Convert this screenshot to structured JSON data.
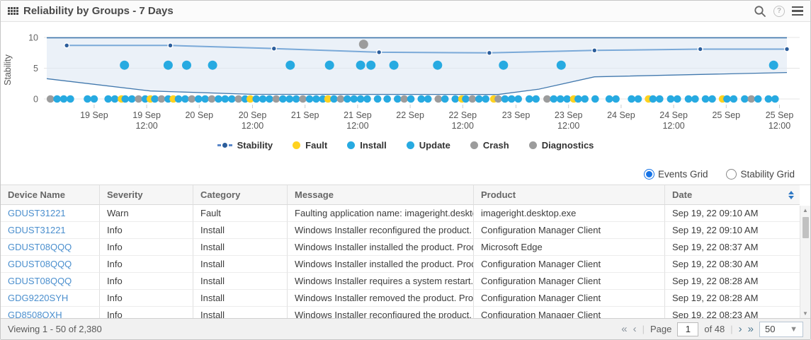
{
  "header": {
    "title": "Reliability by Groups - 7 Days"
  },
  "chart_data": {
    "type": "scatter",
    "title": "Reliability by Groups - 7 Days",
    "ylabel": "Stability",
    "ylim": [
      0,
      10
    ],
    "yticks": [
      {
        "v": 0,
        "label": "0"
      },
      {
        "v": 5,
        "label": "5"
      },
      {
        "v": 10,
        "label": "10"
      }
    ],
    "xticks": [
      {
        "x": 0.064,
        "l1": "19 Sep",
        "l2": ""
      },
      {
        "x": 0.135,
        "l1": "19 Sep",
        "l2": "12:00"
      },
      {
        "x": 0.206,
        "l1": "20 Sep",
        "l2": ""
      },
      {
        "x": 0.278,
        "l1": "20 Sep",
        "l2": "12:00"
      },
      {
        "x": 0.349,
        "l1": "21 Sep",
        "l2": ""
      },
      {
        "x": 0.42,
        "l1": "21 Sep",
        "l2": "12:00"
      },
      {
        "x": 0.491,
        "l1": "22 Sep",
        "l2": ""
      },
      {
        "x": 0.562,
        "l1": "22 Sep",
        "l2": "12:00"
      },
      {
        "x": 0.634,
        "l1": "23 Sep",
        "l2": ""
      },
      {
        "x": 0.705,
        "l1": "23 Sep",
        "l2": "12:00"
      },
      {
        "x": 0.776,
        "l1": "24 Sep",
        "l2": ""
      },
      {
        "x": 0.847,
        "l1": "24 Sep",
        "l2": "12:00"
      },
      {
        "x": 0.918,
        "l1": "25 Sep",
        "l2": ""
      },
      {
        "x": 0.99,
        "l1": "25 Sep",
        "l2": "12:00"
      }
    ],
    "band": {
      "upper": [
        [
          0,
          9.95
        ],
        [
          1,
          9.95
        ]
      ],
      "lower": [
        [
          0,
          3.3
        ],
        [
          0.14,
          1.3
        ],
        [
          0.28,
          0.75
        ],
        [
          0.61,
          0.72
        ],
        [
          0.665,
          1.6
        ],
        [
          0.74,
          3.6
        ],
        [
          1,
          4.3
        ]
      ]
    },
    "stability_line": [
      [
        0.027,
        8.7
      ],
      [
        0.167,
        8.7
      ],
      [
        0.307,
        8.2
      ],
      [
        0.449,
        7.6
      ],
      [
        0.598,
        7.5
      ],
      [
        0.74,
        7.9
      ],
      [
        0.883,
        8.1
      ],
      [
        1,
        8.1
      ]
    ],
    "update_points": {
      "y": 5.5,
      "x": [
        0.105,
        0.164,
        0.189,
        0.224,
        0.329,
        0.382,
        0.424,
        0.438,
        0.469,
        0.528,
        0.617,
        0.695,
        0.982
      ]
    },
    "crash_high_point": {
      "x": 0.428,
      "y": 8.9
    },
    "event_dots": [
      [
        0.005,
        "g"
      ],
      [
        0.014,
        "b"
      ],
      [
        0.023,
        "b"
      ],
      [
        0.032,
        "b"
      ],
      [
        0.055,
        "b"
      ],
      [
        0.064,
        "b"
      ],
      [
        0.083,
        "b"
      ],
      [
        0.092,
        "b"
      ],
      [
        0.101,
        "y"
      ],
      [
        0.106,
        "b"
      ],
      [
        0.115,
        "b"
      ],
      [
        0.124,
        "g"
      ],
      [
        0.133,
        "b"
      ],
      [
        0.14,
        "y"
      ],
      [
        0.146,
        "b"
      ],
      [
        0.155,
        "g"
      ],
      [
        0.164,
        "b"
      ],
      [
        0.171,
        "y"
      ],
      [
        0.178,
        "b"
      ],
      [
        0.187,
        "b"
      ],
      [
        0.196,
        "g"
      ],
      [
        0.205,
        "b"
      ],
      [
        0.214,
        "b"
      ],
      [
        0.223,
        "g"
      ],
      [
        0.232,
        "b"
      ],
      [
        0.241,
        "b"
      ],
      [
        0.25,
        "b"
      ],
      [
        0.259,
        "g"
      ],
      [
        0.268,
        "b"
      ],
      [
        0.275,
        "y"
      ],
      [
        0.283,
        "b"
      ],
      [
        0.292,
        "b"
      ],
      [
        0.301,
        "b"
      ],
      [
        0.31,
        "g"
      ],
      [
        0.319,
        "b"
      ],
      [
        0.328,
        "b"
      ],
      [
        0.337,
        "b"
      ],
      [
        0.346,
        "g"
      ],
      [
        0.355,
        "b"
      ],
      [
        0.364,
        "b"
      ],
      [
        0.373,
        "b"
      ],
      [
        0.38,
        "y"
      ],
      [
        0.388,
        "b"
      ],
      [
        0.397,
        "g"
      ],
      [
        0.406,
        "b"
      ],
      [
        0.415,
        "b"
      ],
      [
        0.424,
        "b"
      ],
      [
        0.433,
        "b"
      ],
      [
        0.447,
        "b"
      ],
      [
        0.46,
        "b"
      ],
      [
        0.474,
        "b"
      ],
      [
        0.483,
        "g"
      ],
      [
        0.492,
        "b"
      ],
      [
        0.506,
        "b"
      ],
      [
        0.515,
        "b"
      ],
      [
        0.529,
        "g"
      ],
      [
        0.538,
        "b"
      ],
      [
        0.552,
        "b"
      ],
      [
        0.561,
        "y"
      ],
      [
        0.566,
        "b"
      ],
      [
        0.575,
        "g"
      ],
      [
        0.584,
        "b"
      ],
      [
        0.593,
        "b"
      ],
      [
        0.604,
        "y"
      ],
      [
        0.61,
        "g"
      ],
      [
        0.619,
        "b"
      ],
      [
        0.628,
        "b"
      ],
      [
        0.637,
        "b"
      ],
      [
        0.652,
        "b"
      ],
      [
        0.661,
        "b"
      ],
      [
        0.676,
        "g"
      ],
      [
        0.685,
        "b"
      ],
      [
        0.694,
        "b"
      ],
      [
        0.703,
        "b"
      ],
      [
        0.712,
        "y"
      ],
      [
        0.718,
        "b"
      ],
      [
        0.727,
        "b"
      ],
      [
        0.741,
        "b"
      ],
      [
        0.76,
        "b"
      ],
      [
        0.769,
        "b"
      ],
      [
        0.79,
        "b"
      ],
      [
        0.799,
        "b"
      ],
      [
        0.813,
        "y"
      ],
      [
        0.819,
        "b"
      ],
      [
        0.828,
        "b"
      ],
      [
        0.843,
        "b"
      ],
      [
        0.852,
        "b"
      ],
      [
        0.867,
        "b"
      ],
      [
        0.876,
        "b"
      ],
      [
        0.89,
        "b"
      ],
      [
        0.899,
        "b"
      ],
      [
        0.913,
        "y"
      ],
      [
        0.919,
        "b"
      ],
      [
        0.928,
        "b"
      ],
      [
        0.943,
        "b"
      ],
      [
        0.952,
        "g"
      ],
      [
        0.961,
        "b"
      ],
      [
        0.975,
        "b"
      ],
      [
        0.984,
        "b"
      ]
    ],
    "colors": {
      "install": "#27aae1",
      "update": "#27aae1",
      "fault": "#ffd21f",
      "crash": "#9c9c9c",
      "diagnostics": "#9c9c9c",
      "stability_line": "#7aa9d8",
      "stability_marker": "#2b5d9b",
      "band_stroke": "#4178ad",
      "band_fill": "#dde8f4"
    },
    "legend": [
      {
        "label": "Stability",
        "type": "line"
      },
      {
        "label": "Fault",
        "color": "#ffd21f"
      },
      {
        "label": "Install",
        "color": "#27aae1"
      },
      {
        "label": "Update",
        "color": "#27aae1"
      },
      {
        "label": "Crash",
        "color": "#9c9c9c"
      },
      {
        "label": "Diagnostics",
        "color": "#9c9c9c"
      }
    ],
    "legend_position": "bottom",
    "grid": true
  },
  "controls": {
    "events_grid_label": "Events Grid",
    "stability_grid_label": "Stability Grid",
    "selected": "Events Grid"
  },
  "table": {
    "columns": [
      {
        "label": "Device Name",
        "sortable": false
      },
      {
        "label": "Severity",
        "sortable": false
      },
      {
        "label": "Category",
        "sortable": false
      },
      {
        "label": "Message",
        "sortable": false
      },
      {
        "label": "Product",
        "sortable": false
      },
      {
        "label": "Date",
        "sortable": true
      }
    ],
    "rows": [
      {
        "device": "GDUST31221",
        "severity": "Warn",
        "category": "Fault",
        "message": "Faulting application name: imageright.desktop.exe",
        "product": "imageright.desktop.exe",
        "date": "Sep 19, 22 09:10 AM"
      },
      {
        "device": "GDUST31221",
        "severity": "Info",
        "category": "Install",
        "message": "Windows Installer reconfigured the product. Product",
        "product": "Configuration Manager Client",
        "date": "Sep 19, 22 09:10 AM"
      },
      {
        "device": "GDUST08QQQ",
        "severity": "Info",
        "category": "Install",
        "message": "Windows Installer installed the product. Product Name",
        "product": "Microsoft Edge",
        "date": "Sep 19, 22 08:37 AM"
      },
      {
        "device": "GDUST08QQQ",
        "severity": "Info",
        "category": "Install",
        "message": "Windows Installer installed the product. Product Name",
        "product": "Configuration Manager Client",
        "date": "Sep 19, 22 08:30 AM"
      },
      {
        "device": "GDUST08QQQ",
        "severity": "Info",
        "category": "Install",
        "message": "Windows Installer requires a system restart. Product",
        "product": "Configuration Manager Client",
        "date": "Sep 19, 22 08:28 AM"
      },
      {
        "device": "GDG9220SYH",
        "severity": "Info",
        "category": "Install",
        "message": "Windows Installer removed the product. Product Name",
        "product": "Configuration Manager Client",
        "date": "Sep 19, 22 08:28 AM"
      },
      {
        "device": "GD8508QXH",
        "severity": "Info",
        "category": "Install",
        "message": "Windows Installer reconfigured the product. Product",
        "product": "Configuration Manager Client",
        "date": "Sep 19, 22 08:23 AM"
      }
    ]
  },
  "footer": {
    "viewing": "Viewing 1 - 50 of 2,380",
    "first_icon": "«",
    "prev_icon": "‹",
    "page_label": "Page",
    "page_value": "1",
    "of_label": "of 48",
    "next_icon": "›",
    "last_icon": "»",
    "page_size": "50"
  }
}
